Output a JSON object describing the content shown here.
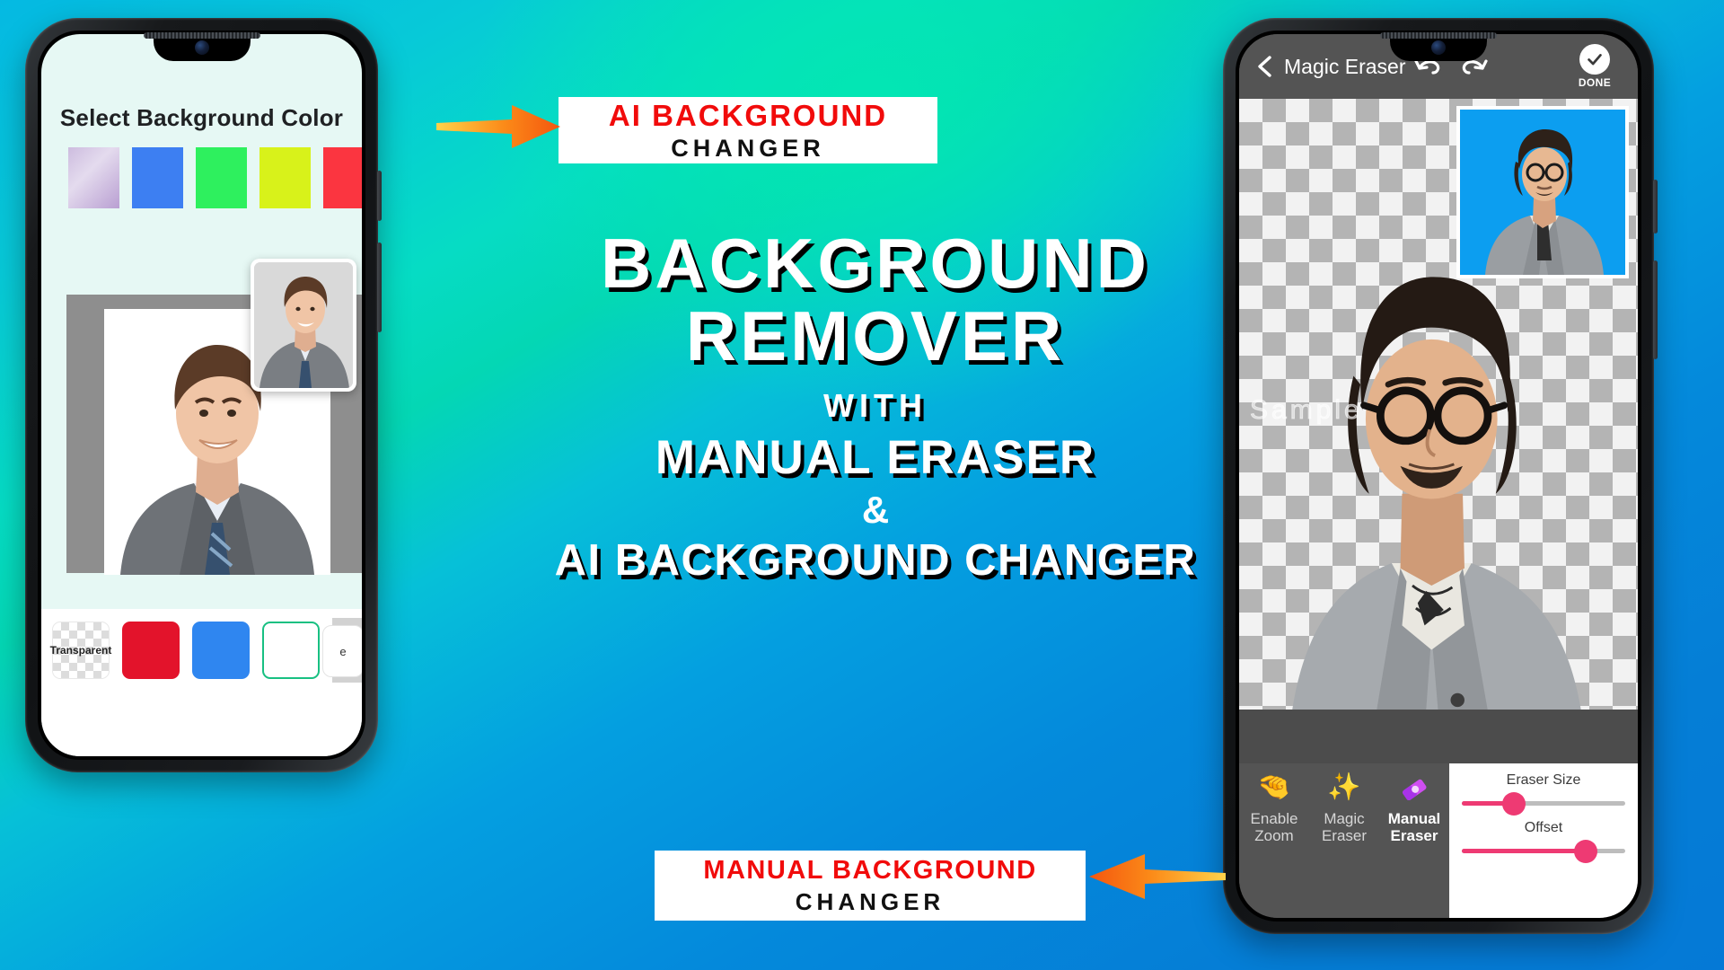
{
  "background": {
    "gradient_from": "#05b9e2",
    "gradient_mid": "#03e7b3",
    "gradient_to": "#0579d6"
  },
  "promo": {
    "top_badge": {
      "line1": "AI BACKGROUND",
      "line2": "CHANGER"
    },
    "bottom_badge": {
      "line1": "MANUAL BACKGROUND",
      "line2": "CHANGER"
    },
    "headline_1": "BACKGROUND",
    "headline_2": "REMOVER",
    "with": "WITH",
    "headline_3": "MANUAL ERASER",
    "amp": "&",
    "headline_4": "AI BACKGROUND CHANGER",
    "accent_red": "#f10b0b",
    "accent_black": "#111111",
    "arrow_color_start": "#ffd24a",
    "arrow_color_end": "#f4560f"
  },
  "left_phone": {
    "screen_title": "Select Background Color",
    "top_swatches": [
      {
        "name": "lavender-gradient",
        "color": "#c7b3da"
      },
      {
        "name": "blue",
        "color": "#3d7ff2"
      },
      {
        "name": "green",
        "color": "#2ef05e"
      },
      {
        "name": "yellow-green",
        "color": "#d8f21a"
      },
      {
        "name": "red",
        "color": "#fb3540"
      }
    ],
    "picker": [
      {
        "name": "transparent",
        "label": "Transparent",
        "color": "transparent"
      },
      {
        "name": "red",
        "label": "",
        "color": "#e3132b"
      },
      {
        "name": "blue",
        "label": "",
        "color": "#2f86f0"
      },
      {
        "name": "white-selected",
        "label": "",
        "color": "#ffffff",
        "selected": true
      },
      {
        "name": "grey",
        "label": "",
        "color": "#d2d2d2"
      }
    ],
    "cut_off_label": "e"
  },
  "right_phone": {
    "app_bar": {
      "back": "‹",
      "title": "Magic Eraser",
      "undo_icon": "undo-icon",
      "redo_icon": "redo-icon",
      "done_label": "DONE",
      "done_icon": "check-icon"
    },
    "canvas": {
      "watermark": "Sample",
      "preview_bg_color": "#0c9ef0"
    },
    "tools": [
      {
        "name": "enable-zoom",
        "label": "Enable Zoom",
        "glyph": "🤏",
        "active": false
      },
      {
        "name": "magic-eraser",
        "label": "Magic Eraser",
        "glyph": "✨",
        "active": false
      },
      {
        "name": "manual-eraser",
        "label": "Manual Eraser",
        "glyph": "🖌",
        "active": true
      }
    ],
    "sliders": [
      {
        "name": "eraser-size",
        "label": "Eraser Size",
        "value": 32,
        "color": "#ee3a73"
      },
      {
        "name": "offset",
        "label": "Offset",
        "value": 76,
        "color": "#ee3a73"
      }
    ]
  }
}
